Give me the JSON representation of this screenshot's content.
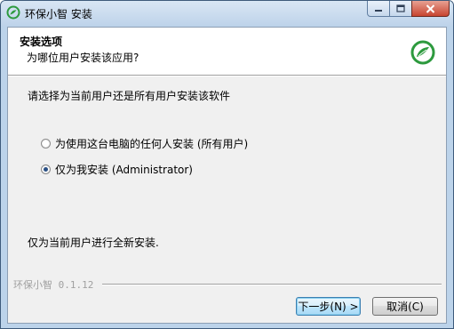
{
  "window": {
    "title": "环保小智 安装",
    "minimize_glyph": "—",
    "maximize_glyph": "□",
    "close_glyph": "✕"
  },
  "header": {
    "title": "安装选项",
    "subtitle": "为哪位用户安装该应用?"
  },
  "body": {
    "prompt": "请选择为当前用户还是所有用户安装该软件",
    "options": [
      {
        "label": "为使用这台电脑的任何人安装 (所有用户)",
        "checked": false
      },
      {
        "label": "仅为我安装 (Administrator)",
        "checked": true
      }
    ],
    "description": "仅为当前用户进行全新安装."
  },
  "footer": {
    "brand": "环保小智 0.1.12",
    "next_label": "下一步(N) >",
    "cancel_label": "取消(C)"
  },
  "icons": {
    "app_icon": "leaf-ring-logo-icon",
    "logo": "leaf-ring-logo-icon"
  },
  "colors": {
    "brand_green": "#2d9a3e",
    "titlebar": "#c4d8ee",
    "close_button": "#c7442f",
    "panel": "#f0f0f0"
  }
}
